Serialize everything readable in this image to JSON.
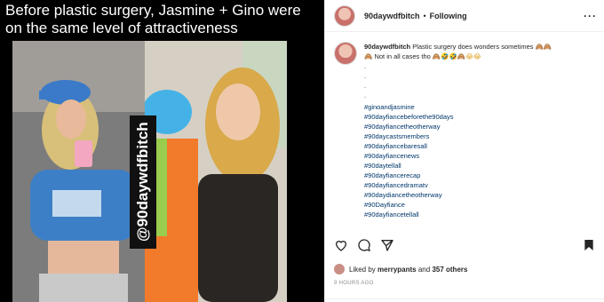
{
  "media": {
    "caption": "Before plastic surgery, Jasmine + Gino were on the same level of attractiveness",
    "watermark": "@90daywdfbitch"
  },
  "header": {
    "username": "90daywdfbitch",
    "separator": "•",
    "follow_status": "Following",
    "more_icon": "more-icon"
  },
  "comment": {
    "username": "90daywdfbitch",
    "text_line1": "Plastic surgery does wonders sometimes",
    "text_line2": "Not in all cases tho",
    "dots": [
      ".",
      ".",
      ".",
      "."
    ],
    "hashtags": [
      "#ginoandjasmine",
      "#90dayfiancebeforethe90days",
      "#90dayfiancetheotherway",
      "#90daycastsmembers",
      "#90dayfiancebaresall",
      "#90dayfiancenews",
      "#90daytellall",
      "#90dayfiancerecap",
      "#90dayfiancedramatv",
      "#90daydiancetheotherway",
      "#90Dayfiance",
      "#90dayfiancetellall"
    ]
  },
  "actions": {
    "like_icon": "heart-icon",
    "comment_icon": "comment-icon",
    "share_icon": "share-icon",
    "save_icon": "bookmark-icon"
  },
  "likes": {
    "prefix": "Liked by",
    "user": "merrypants",
    "suffix": "and",
    "others": "357 others"
  },
  "timestamp": "9 HOURS AGO"
}
